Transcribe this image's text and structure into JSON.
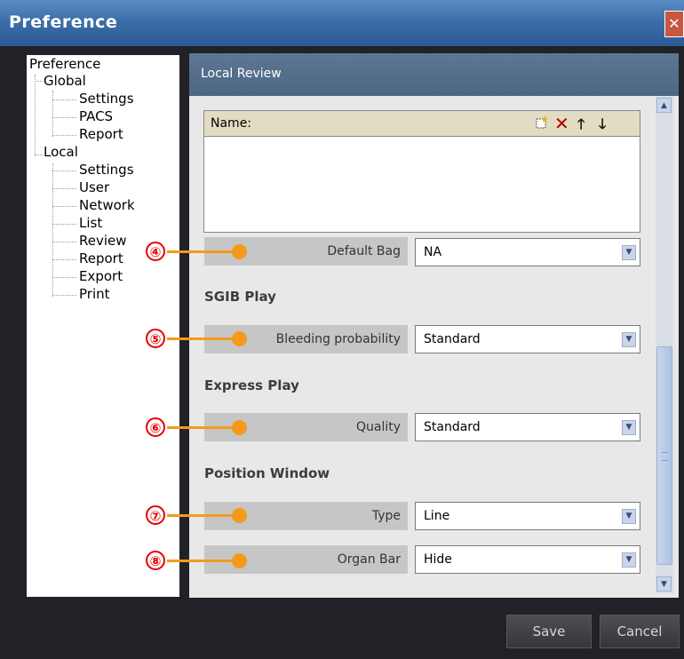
{
  "window": {
    "title": "Preference"
  },
  "tree": {
    "root": "Preference",
    "global": {
      "label": "Global",
      "children": [
        "Settings",
        "PACS",
        "Report"
      ]
    },
    "local": {
      "label": "Local",
      "children": [
        "Settings",
        "User",
        "Network",
        "List",
        "Review",
        "Report",
        "Export",
        "Print"
      ]
    }
  },
  "panel": {
    "title": "Local Review",
    "name_box": {
      "label": "Name:"
    },
    "default_bag": {
      "label": "Default Bag",
      "value": "NA"
    },
    "sgib": {
      "section": "SGIB Play",
      "label": "Bleeding probability",
      "value": "Standard"
    },
    "express": {
      "section": "Express Play",
      "label": "Quality",
      "value": "Standard"
    },
    "position": {
      "section": "Position Window",
      "type_label": "Type",
      "type_value": "Line",
      "organ_label": "Organ Bar",
      "organ_value": "Hide"
    }
  },
  "callouts": [
    "④",
    "⑤",
    "⑥",
    "⑦",
    "⑧"
  ],
  "buttons": {
    "save": "Save",
    "cancel": "Cancel"
  },
  "icons": [
    "new-item-icon",
    "delete-icon",
    "move-up-icon",
    "move-down-icon",
    "chevron-down-icon",
    "close-icon"
  ],
  "colors": {
    "callout_line": "#f39a1b",
    "callout_number": "#e80000",
    "titlebar": "#3d6ea9"
  }
}
